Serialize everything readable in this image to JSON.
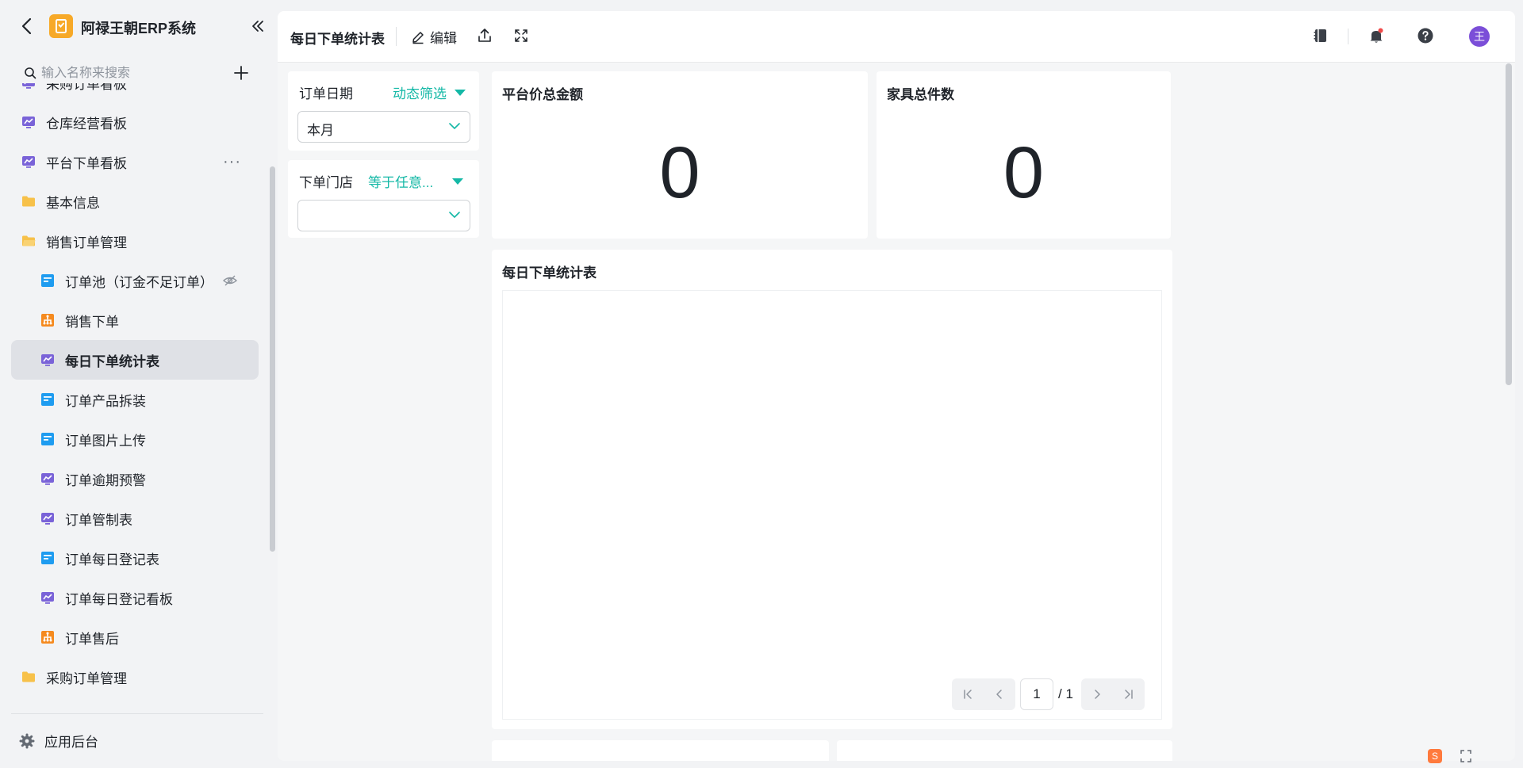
{
  "sidebar": {
    "app_name": "阿禄王朝ERP系统",
    "search_placeholder": "输入名称来搜索",
    "items": [
      {
        "label": "采购订单看板",
        "icon": "dashboard-icon",
        "level": 0
      },
      {
        "label": "仓库经营看板",
        "icon": "dashboard-icon",
        "level": 0
      },
      {
        "label": "平台下单看板",
        "icon": "dashboard-icon",
        "level": 0
      },
      {
        "label": "基本信息",
        "icon": "folder-icon",
        "level": 0
      },
      {
        "label": "销售订单管理",
        "icon": "folder-open-icon",
        "level": 0
      },
      {
        "label": "订单池（订金不足订单）",
        "icon": "form-icon",
        "level": 1
      },
      {
        "label": "销售下单",
        "icon": "process-icon",
        "level": 1
      },
      {
        "label": "每日下单统计表",
        "icon": "dashboard-icon",
        "level": 1
      },
      {
        "label": "订单产品拆装",
        "icon": "form-icon",
        "level": 1
      },
      {
        "label": "订单图片上传",
        "icon": "form-icon",
        "level": 1
      },
      {
        "label": "订单逾期预警",
        "icon": "dashboard-icon",
        "level": 1
      },
      {
        "label": "订单管制表",
        "icon": "dashboard-icon",
        "level": 1
      },
      {
        "label": "订单每日登记表",
        "icon": "form-icon",
        "level": 1
      },
      {
        "label": "订单每日登记看板",
        "icon": "dashboard-icon",
        "level": 1
      },
      {
        "label": "订单售后",
        "icon": "process-icon",
        "level": 1
      },
      {
        "label": "采购订单管理",
        "icon": "folder-icon",
        "level": 0
      }
    ],
    "footer_label": "应用后台"
  },
  "topbar": {
    "title": "每日下单统计表",
    "edit_label": "编辑",
    "avatar_text": "王"
  },
  "filters": {
    "date": {
      "label": "订单日期",
      "mode": "动态筛选",
      "value": "本月"
    },
    "store": {
      "label": "下单门店",
      "mode": "等于任意...",
      "value": ""
    }
  },
  "kpis": [
    {
      "title": "平台价总金额",
      "value": "0"
    },
    {
      "title": "家具总件数",
      "value": "0"
    }
  ],
  "table": {
    "title": "每日下单统计表",
    "current_page": "1",
    "total_pages": "/ 1"
  },
  "colors": {
    "accent": "#14b8a6",
    "avatar": "#7b4ed8",
    "folder": "#f7c14a",
    "dashboard": "#7a63d8",
    "form": "#1f9cf0",
    "process": "#f58a1f"
  }
}
